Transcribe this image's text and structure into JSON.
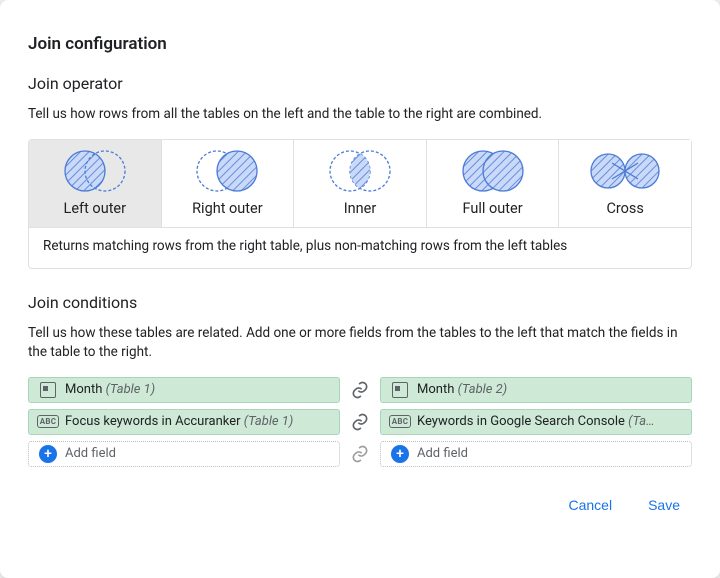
{
  "title": "Join configuration",
  "operator": {
    "heading": "Join operator",
    "desc": "Tell us how rows from all the tables on the left and the table to the right are combined.",
    "options": {
      "left": "Left outer",
      "right": "Right outer",
      "inner": "Inner",
      "full": "Full outer",
      "cross": "Cross"
    },
    "selected": "left",
    "explain": "Returns matching rows from the right table, plus non-matching rows from the left tables"
  },
  "conditions": {
    "heading": "Join conditions",
    "desc": "Tell us how these tables are related. Add one or more fields from the tables to the left that match the fields in the table to the right.",
    "rows": [
      {
        "left": {
          "icon": "calendar",
          "field": "Month",
          "table": "(Table 1)"
        },
        "right": {
          "icon": "calendar",
          "field": "Month",
          "table": "(Table 2)"
        }
      },
      {
        "left": {
          "icon": "abc",
          "field": "Focus keywords in Accuranker",
          "table": "(Table 1)"
        },
        "right": {
          "icon": "abc",
          "field": "Keywords in Google Search Console",
          "table": "(Ta…"
        }
      }
    ],
    "add_label": "Add field"
  },
  "actions": {
    "cancel": "Cancel",
    "save": "Save"
  }
}
